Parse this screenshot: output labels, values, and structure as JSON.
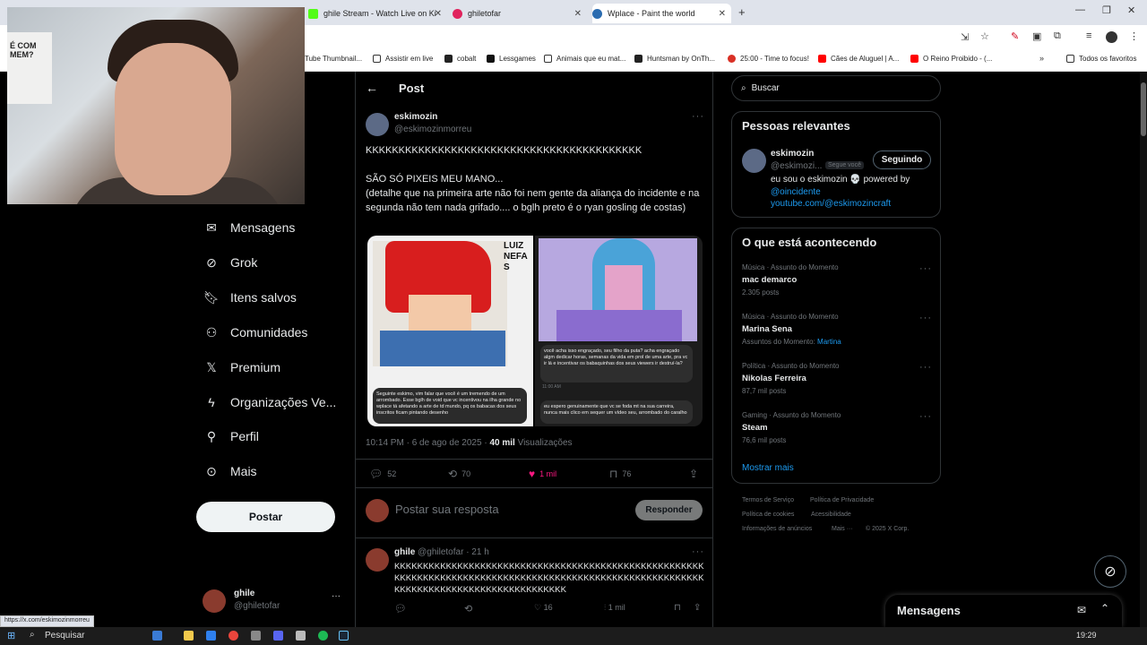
{
  "browser": {
    "tabs": [
      {
        "label": "ghile Stream - Watch Live on Ki",
        "color": "#53fc18"
      },
      {
        "label": "ghiletofar",
        "color": "#e0245e"
      },
      {
        "label": "Wplace - Paint the world",
        "color": "#2b6cb0"
      }
    ],
    "bookmarks": [
      {
        "label": "Tube Thumbnail..."
      },
      {
        "label": "Assistir em live"
      },
      {
        "label": "cobalt"
      },
      {
        "label": "Lessgames"
      },
      {
        "label": "Animais que eu mat..."
      },
      {
        "label": "Huntsman by OnTh..."
      },
      {
        "label": "25:00 - Time to focus!"
      },
      {
        "label": "Cães de Aluguel | A..."
      },
      {
        "label": "O Reino Proibido - (..."
      },
      {
        "label": "Todos os favoritos"
      }
    ],
    "status_url": "https://x.com/eskimozinmorreu"
  },
  "webcam": {
    "poster_text": "É COM MEM?"
  },
  "nav": {
    "items": [
      {
        "label": "Mensagens",
        "icon": "mail-icon"
      },
      {
        "label": "Grok",
        "icon": "grok-icon"
      },
      {
        "label": "Itens salvos",
        "icon": "bookmark-icon"
      },
      {
        "label": "Comunidades",
        "icon": "communities-icon"
      },
      {
        "label": "Premium",
        "icon": "x-logo-icon"
      },
      {
        "label": "Organizações Ve...",
        "icon": "lightning-icon"
      },
      {
        "label": "Perfil",
        "icon": "person-icon"
      },
      {
        "label": "Mais",
        "icon": "more-circle-icon"
      }
    ],
    "post_button": "Postar",
    "account": {
      "name": "ghile",
      "handle": "@ghiletofar",
      "more": "···"
    }
  },
  "post": {
    "header_title": "Post",
    "author": {
      "name": "eskimozin",
      "handle": "@eskimozinmorreu"
    },
    "text_line1": "KKKKKKKKKKKKKKKKKKKKKKKKKKKKKKKKKKKKKKKKKK",
    "text_line2": "SÃO SÓ PIXEIS MEU MANO...",
    "text_line3": "(detalhe que na primeira arte não foi nem gente da aliança do incidente e na segunda não tem nada grifado.... o bglh preto é o ryan gosling de costas)",
    "timestamp": "10:14 PM · 6 de ago de 2025 · ",
    "views_count": "40 mil",
    "views_label": " Visualizações",
    "replies": "52",
    "reposts": "70",
    "likes": "1 mil",
    "bookmarks": "76",
    "reply_placeholder": "Postar sua resposta",
    "reply_button": "Responder",
    "media_left_caption": "Seguinte eskimo, vim falar que você é um tremendo de um arrombado. Esse bglh de void que vc incentivou na ilha grande no wplace tá afetando a arte de td mundo, pq os babacas dos seus inscritos ficam pintando desenho",
    "media_right_msg1": "você acha isso engraçado, seu filho da puta? acha engraçado algm dedicar horas, semanas da vida em prol de uma arte, pra vc ir lá e incentivar os babaquinhas dos seus viewers ir destruí-la?",
    "media_right_msg2": "eu espero genuinamente que vc se foda mt na sua carreira, nunca mais clico em sequer um vídeo seu, arrombado do caralho",
    "media_right_time": "11:00 AM"
  },
  "reply": {
    "name": "ghile",
    "handle": "@ghiletofar",
    "time": "· 21 h",
    "text": "KKKKKKKKKKKKKKKKKKKKKKKKKKKKKKKKKKKKKKKKKKKKKKKKKKKKKKKKKKKKKKKKKKKKKKKKKKKKKKKKKKKKKKKKKKKKKKKKKKKKKKKKKKKKKKKKKKKKKKKKKKKKKKKKKKKKKKKKKK",
    "likes": "16",
    "views": "1 mil"
  },
  "sidebar": {
    "search_placeholder": "Buscar",
    "relevant_title": "Pessoas relevantes",
    "relevant_user": {
      "name": "eskimozin",
      "handle": "@eskimozi...",
      "follows_you": "Segue você",
      "follow_button": "Seguindo",
      "bio_1": "eu sou o eskimozin 💀 powered by",
      "bio_link1": "@oincidente",
      "bio_link2": "youtube.com/@eskimozincraft"
    },
    "trends_title": "O que está acontecendo",
    "trends": [
      {
        "category": "Música · Assunto do Momento",
        "name": "mac demarco",
        "count": "2.305 posts"
      },
      {
        "category": "Música · Assunto do Momento",
        "name": "Marina Sena",
        "count": "Assuntos do Momento: ",
        "extra": "Martina"
      },
      {
        "category": "Política · Assunto do Momento",
        "name": "Nikolas Ferreira",
        "count": "87,7 mil posts"
      },
      {
        "category": "Gaming · Assunto do Momento",
        "name": "Steam",
        "count": "76,6 mil posts"
      }
    ],
    "show_more": "Mostrar mais",
    "footer": [
      "Termos de Serviço",
      "Política de Privacidade",
      "Política de cookies",
      "Acessibilidade",
      "Informações de anúncios",
      "Mais ···",
      "© 2025 X Corp."
    ],
    "messages_dock": "Mensagens"
  },
  "taskbar": {
    "search": "Pesquisar",
    "time": "19:29"
  },
  "colors": {
    "accent": "#1d9bf0",
    "like": "#f91880",
    "bg": "#000000",
    "border": "#2f3336"
  }
}
